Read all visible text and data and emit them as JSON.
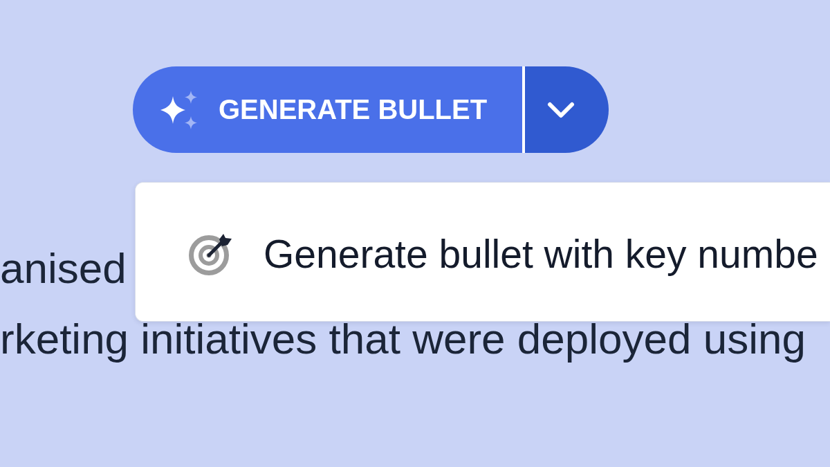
{
  "split_button": {
    "label": "GENERATE BULLET"
  },
  "menu": {
    "items": [
      {
        "label": "Generate bullet with key numbe"
      }
    ]
  },
  "background_text": {
    "lines": [
      "anised",
      "rketing initiatives that were deployed using"
    ]
  }
}
